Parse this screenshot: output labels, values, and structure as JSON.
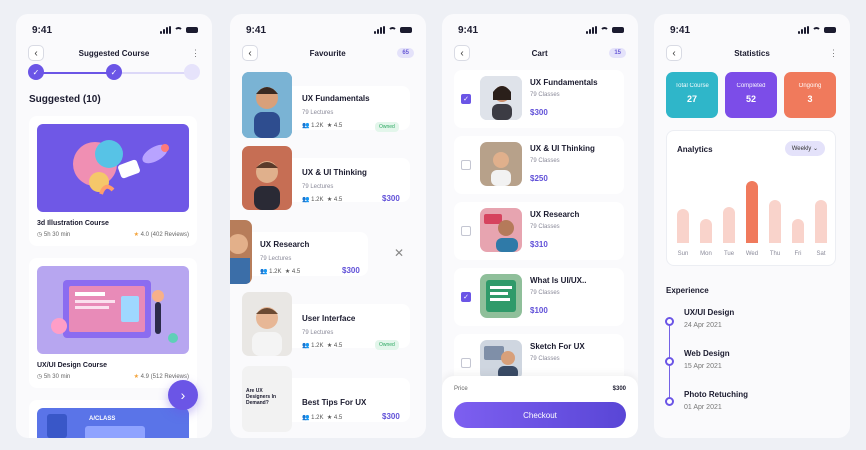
{
  "status_time": "9:41",
  "suggested": {
    "nav_title": "Suggested Course",
    "section_title": "Suggested (10)",
    "courses": [
      {
        "name": "3d Illustration Course",
        "duration": "5h 30 min",
        "rating": "4.0",
        "reviews": "(402 Reviews)"
      },
      {
        "name": "UX/UI Design Course",
        "duration": "5h 30 min",
        "rating": "4.9",
        "reviews": "(512 Reviews)"
      },
      {
        "name": "",
        "duration": "",
        "rating": "",
        "reviews": "",
        "card_text": "A/CLASS"
      }
    ]
  },
  "favourite": {
    "nav_title": "Favourite",
    "count": "65",
    "items": [
      {
        "title": "UX Fundamentals",
        "sub": "79 Lectures",
        "students": "1.2K",
        "rating": "4.5",
        "tag": "Owned",
        "price": ""
      },
      {
        "title": "UX & UI Thinking",
        "sub": "79 Lectures",
        "students": "1.2K",
        "rating": "4.5",
        "tag": "",
        "price": "$300"
      },
      {
        "title": "UX Research",
        "sub": "79 Lectures",
        "students": "1.2K",
        "rating": "4.5",
        "tag": "",
        "price": "$300"
      },
      {
        "title": "User Interface",
        "sub": "79 Lectures",
        "students": "1.2K",
        "rating": "4.5",
        "tag": "Owned",
        "price": ""
      },
      {
        "title": "Best Tips For UX",
        "sub": "",
        "students": "1.2K",
        "rating": "4.5",
        "tag": "",
        "price": "$300",
        "thumb_text": "Are UX Designers In Demand?"
      }
    ]
  },
  "cart": {
    "nav_title": "Cart",
    "count": "15",
    "items": [
      {
        "title": "UX Fundamentals",
        "sub": "79 Classes",
        "price": "$300",
        "checked": true
      },
      {
        "title": "UX & UI Thinking",
        "sub": "79 Classes",
        "price": "$250",
        "checked": false
      },
      {
        "title": "UX Research",
        "sub": "79 Classes",
        "price": "$310",
        "checked": false
      },
      {
        "title": "What Is UI/UX..",
        "sub": "79 Classes",
        "price": "$100",
        "checked": true
      },
      {
        "title": "Sketch For UX",
        "sub": "79 Classes",
        "price": "",
        "checked": false
      }
    ],
    "price_label": "Price",
    "price_value": "$300",
    "checkout_label": "Checkout"
  },
  "statistics": {
    "nav_title": "Statistics",
    "cards": [
      {
        "label": "Total Course",
        "value": "27",
        "color": "#2fb6c9"
      },
      {
        "label": "Completed",
        "value": "52",
        "color": "#7c4de8"
      },
      {
        "label": "Ongoing",
        "value": "3",
        "color": "#f07a5c"
      }
    ],
    "analytics_title": "Analytics",
    "period": "Weekly",
    "experience_title": "Experience",
    "experience": [
      {
        "title": "UX/UI Design",
        "date": "24 Apr 2021"
      },
      {
        "title": "Web Design",
        "date": "15 Apr 2021"
      },
      {
        "title": "Photo Retuching",
        "date": "01 Apr 2021"
      }
    ]
  },
  "chart_data": {
    "type": "bar",
    "categories": [
      "Sun",
      "Mon",
      "Tue",
      "Wed",
      "Thu",
      "Fri",
      "Sat"
    ],
    "values": [
      34,
      24,
      36,
      62,
      43,
      24,
      43
    ],
    "highlight_index": 3,
    "colors": {
      "normal": "#f9d3cb",
      "highlight": "#f07a5c"
    }
  }
}
